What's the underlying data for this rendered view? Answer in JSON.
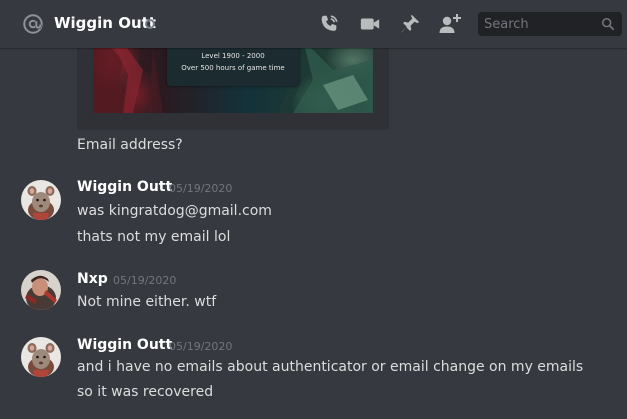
{
  "header": {
    "channel_name": "Wiggin Outt",
    "icons": [
      "at-icon",
      "phone-call-icon",
      "video-camera-icon",
      "pin-icon",
      "add-friend-icon"
    ],
    "search_placeholder": "Search"
  },
  "embed": {
    "line1": "Level 1900 - 2000",
    "line2": "Over 500 hours of game time"
  },
  "messages": [
    {
      "kind": "continuation",
      "text": "Email address?"
    },
    {
      "kind": "group",
      "author": "Wiggin Outt",
      "timestamp": "05/19/2020",
      "avatar": "rat-avatar",
      "lines": [
        "was kingratdog@gmail.com",
        "thats not my email lol"
      ]
    },
    {
      "kind": "group",
      "author": "Nxp",
      "timestamp": "05/19/2020",
      "avatar": "nxp-avatar",
      "lines": [
        "Not mine either. wtf"
      ]
    },
    {
      "kind": "group",
      "author": "Wiggin Outt",
      "timestamp": "05/19/2020",
      "avatar": "rat-avatar",
      "lines": [
        "and i have no emails about authenticator or email change on my emails",
        "so it was recovered"
      ]
    }
  ],
  "colors": {
    "background": "#36393f",
    "search_bg": "#202225",
    "text": "#dcddde",
    "timestamp": "#72767d",
    "header_icon": "#b9bbbe"
  }
}
